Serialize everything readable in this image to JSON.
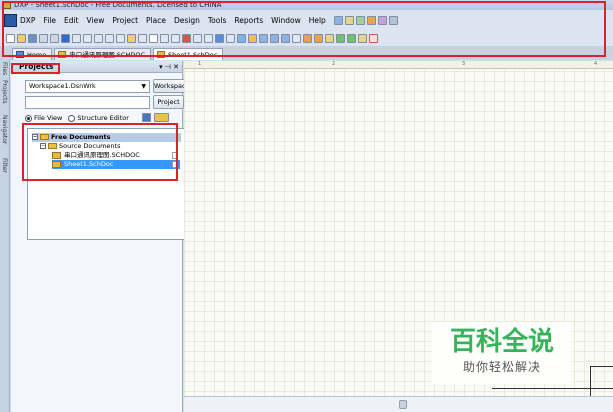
{
  "window": {
    "title": "DXP - Sheet1.SchDoc - Free Documents. Licensed to CHINA"
  },
  "menubar": {
    "items": [
      "DXP",
      "File",
      "Edit",
      "View",
      "Project",
      "Place",
      "Design",
      "Tools",
      "Reports",
      "Window",
      "Help"
    ]
  },
  "tabs": [
    {
      "label": "Home",
      "icon": "home-icon"
    },
    {
      "label": "串口通讯原理图.SCHDOC",
      "icon": "schematic-doc-icon"
    },
    {
      "label": "Sheet1.SchDoc",
      "icon": "schematic-doc-icon"
    }
  ],
  "side_tabs": [
    "Files",
    "Projects",
    "Navigator",
    "Filter"
  ],
  "panel": {
    "title": "Projects",
    "controls": "▾ ⊣ ✕",
    "workspace_value": "Workspace1.DsnWrk",
    "workspace_button": "Workspace",
    "project_button": "Project",
    "radio_file_view": "File View",
    "radio_structure_editor": "Structure Editor",
    "tree": {
      "root": "Free Documents",
      "folder": "Source Documents",
      "documents": [
        "串口通讯原理图.SCHDOC",
        "Sheet1.SchDoc"
      ]
    }
  },
  "ruler": {
    "ticks": [
      "1",
      "2",
      "3",
      "4"
    ]
  },
  "watermark": {
    "title": "百科全说",
    "subtitle": "助你轻松解决"
  },
  "colors": {
    "highlight_box": "#d8232a",
    "selected_row": "#3399ff",
    "watermark_green": "#35b45a"
  }
}
